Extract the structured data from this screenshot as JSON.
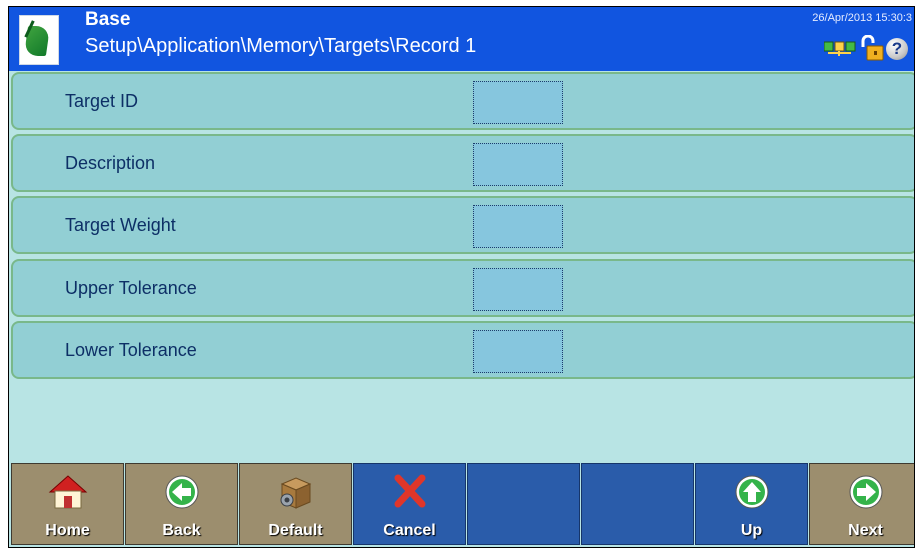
{
  "header": {
    "title": "Base",
    "path": "Setup\\Application\\Memory\\Targets\\Record 1",
    "datetime": "26/Apr/2013 15:30:3"
  },
  "fields": [
    {
      "label": "Target ID",
      "value": ""
    },
    {
      "label": "Description",
      "value": ""
    },
    {
      "label": "Target Weight",
      "value": ""
    },
    {
      "label": "Upper Tolerance",
      "value": ""
    },
    {
      "label": "Lower Tolerance",
      "value": ""
    }
  ],
  "softkeys": [
    {
      "label": "Home",
      "icon": "home-icon"
    },
    {
      "label": "Back",
      "icon": "back-arrow-icon"
    },
    {
      "label": "Default",
      "icon": "default-box-icon"
    },
    {
      "label": "Cancel",
      "icon": "cancel-x-icon"
    },
    {
      "label": "",
      "icon": ""
    },
    {
      "label": "",
      "icon": ""
    },
    {
      "label": "Up",
      "icon": "up-arrow-icon"
    },
    {
      "label": "Next",
      "icon": "next-arrow-icon"
    }
  ],
  "colors": {
    "header_bg": "#1155e0",
    "row_bg": "#92cfd4",
    "field_bg": "#86c6de",
    "softkey_brown": "#9c8e6e",
    "softkey_blue": "#2a5caa"
  }
}
